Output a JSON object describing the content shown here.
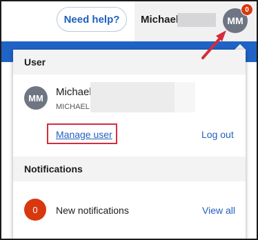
{
  "header": {
    "help_label": "Need help?",
    "user_name": "Michael",
    "avatar_initials": "MM",
    "notification_count": "0"
  },
  "dropdown": {
    "user_section_title": "User",
    "user": {
      "avatar_initials": "MM",
      "name": "Michael",
      "id": "MICHAEL"
    },
    "manage_user_label": "Manage user",
    "logout_label": "Log out",
    "notifications_section_title": "Notifications",
    "notifications": {
      "count": "0",
      "text": "New notifications",
      "view_all_label": "View all"
    }
  },
  "colors": {
    "accent_blue": "#1f63c7",
    "link_blue": "#1f5fbf",
    "badge_red": "#d8380e",
    "highlight_red": "#d62b3b"
  }
}
